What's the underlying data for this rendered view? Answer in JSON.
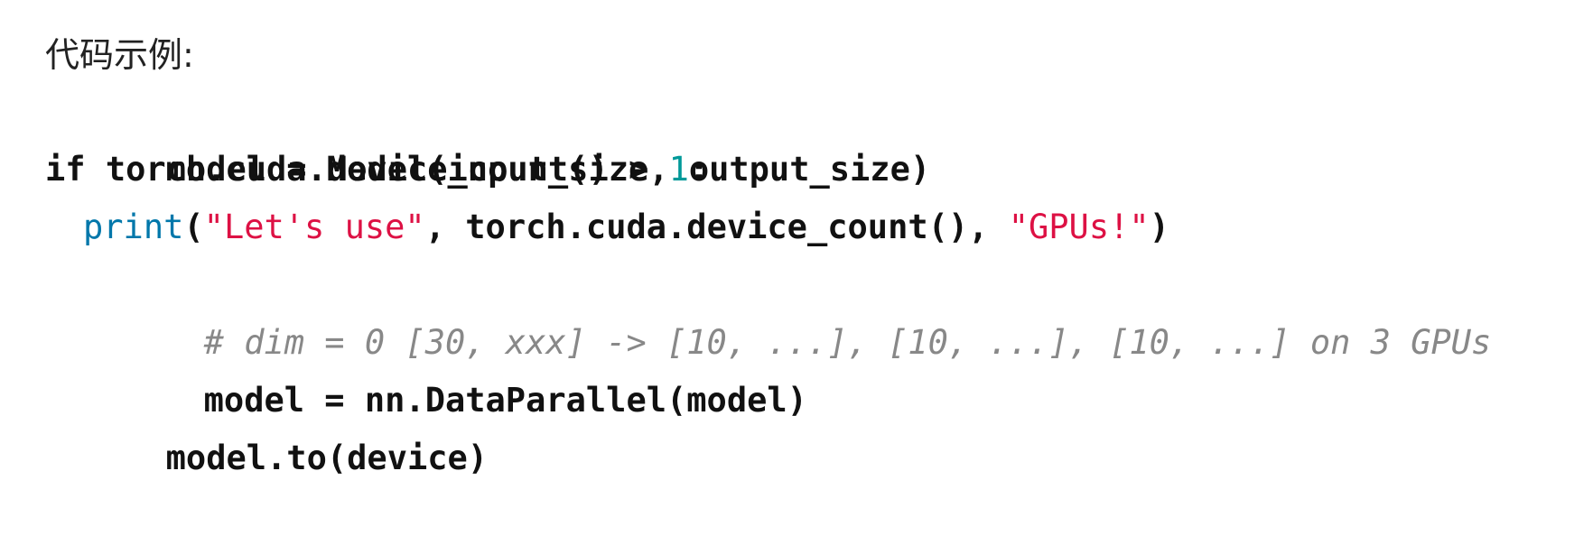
{
  "heading": "代码示例:",
  "code": {
    "line1": "model = Model(input_size, output_size)",
    "line2": {
      "before": "if torch.cuda.device_count() > ",
      "number": "1",
      "after": ":"
    },
    "line3": {
      "function": "print",
      "open": "(",
      "string1": "\"Let's use\"",
      "middle": ", torch.cuda.device_count(), ",
      "string2": "\"GPUs!\"",
      "close": ")"
    },
    "line4": "# dim = 0 [30, xxx] -> [10, ...], [10, ...], [10, ...] on 3 GPUs",
    "line5": "model = nn.DataParallel(model)",
    "line6": "model.to(device)"
  },
  "colors": {
    "function": "#0077aa",
    "string": "#dd1144",
    "number": "#009999",
    "comment": "#888888",
    "text": "#111111"
  }
}
